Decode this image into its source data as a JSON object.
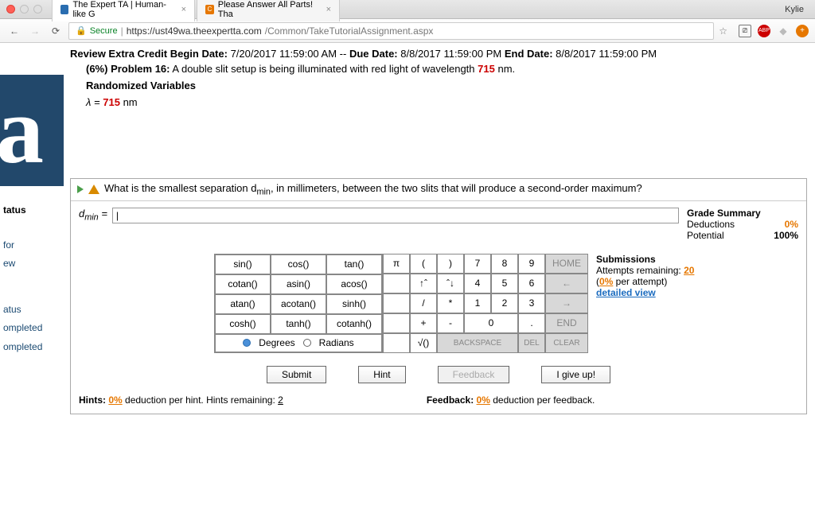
{
  "chrome": {
    "tabs": [
      {
        "title": "The Expert TA | Human-like G"
      },
      {
        "title": "Please Answer All Parts! Tha"
      }
    ],
    "user": "Kylie",
    "secure_label": "Secure",
    "url_host": "https://ust49wa.theexpertta.com",
    "url_path": "/Common/TakeTutorialAssignment.aspx",
    "star": "☆"
  },
  "sidebar": {
    "items": [
      "tatus",
      "for",
      "ew",
      "atus",
      "ompleted",
      "ompleted"
    ]
  },
  "header": {
    "review_label": "Review Extra Credit Begin Date:",
    "begin_date": "7/20/2017 11:59:00 AM",
    "due_label": "Due Date:",
    "due_date": "8/8/2017 11:59:00 PM",
    "end_label": "End Date:",
    "end_date": "8/8/2017 11:59:00 PM"
  },
  "problem": {
    "pct": "(6%)",
    "label": "Problem 16:",
    "text_a": "A double slit setup is being illuminated with red light of wavelength",
    "wavelength": "715",
    "text_b": "nm.",
    "rand_label": "Randomized Variables",
    "lambda_text": "λ =",
    "lambda_val": "715",
    "lambda_unit": "nm"
  },
  "question": {
    "text_a": "What is the smallest separation d",
    "text_sub": "min",
    "text_b": ", in millimeters, between the two slits that will produce a second-order maximum?"
  },
  "answer": {
    "label_a": "d",
    "label_sub": "min",
    "label_eq": "="
  },
  "grade": {
    "title": "Grade Summary",
    "deductions_label": "Deductions",
    "deductions_val": "0%",
    "potential_label": "Potential",
    "potential_val": "100%"
  },
  "calc": {
    "funcs": [
      "sin()",
      "cos()",
      "tan()",
      "cotan()",
      "asin()",
      "acos()",
      "atan()",
      "acotan()",
      "sinh()",
      "cosh()",
      "tanh()",
      "cotanh()"
    ],
    "degrees": "Degrees",
    "radians": "Radians",
    "row1": [
      "π",
      "(",
      ")",
      "7",
      "8",
      "9"
    ],
    "row1_end": "HOME",
    "row2": [
      "",
      "↑ˆ",
      "ˆ↓",
      "4",
      "5",
      "6"
    ],
    "row2_end": "←",
    "row3": [
      "",
      "/",
      "*",
      "1",
      "2",
      "3"
    ],
    "row3_end": "→",
    "row4": [
      "",
      "+",
      "-",
      "0",
      "0",
      "."
    ],
    "row4_end": "END",
    "row5": [
      "",
      "√()",
      "BACKSPACE",
      "BACKSPACE",
      "DEL"
    ],
    "row5_end": "CLEAR"
  },
  "submissions": {
    "title": "Submissions",
    "attempts_label": "Attempts remaining:",
    "attempts_val": "20",
    "per_attempt_a": "(",
    "per_attempt_pct": "0%",
    "per_attempt_b": " per attempt)",
    "detailed": "detailed view"
  },
  "actions": {
    "submit": "Submit",
    "hint": "Hint",
    "feedback": "Feedback",
    "giveup": "I give up!"
  },
  "footer": {
    "hints_a": "Hints:",
    "hints_pct": "0%",
    "hints_b": "deduction per hint. Hints remaining:",
    "hints_rem": "2",
    "feedback_a": "Feedback:",
    "feedback_pct": "0%",
    "feedback_b": "deduction per feedback."
  }
}
